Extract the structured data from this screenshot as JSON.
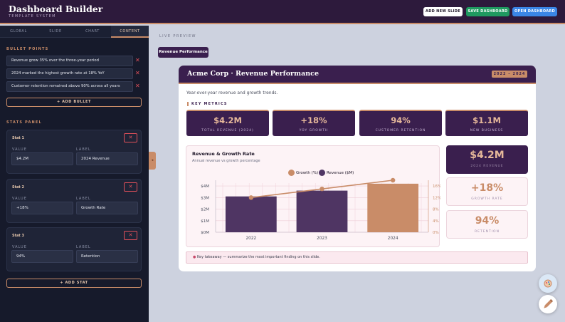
{
  "header": {
    "title": "Dashboard Builder",
    "subtitle": "TEMPLATE SYSTEM",
    "add_slide": "ADD NEW SLIDE",
    "save": "SAVE DASHBOARD",
    "open": "OPEN DASHBOARD"
  },
  "sidebar": {
    "tabs": [
      "GLOBAL",
      "SLIDE",
      "CHART",
      "CONTENT"
    ],
    "active_tab": "CONTENT",
    "bullets_label": "BULLET POINTS",
    "bullets": [
      "Revenue grew 35% over the three-year period",
      "2024 marked the highest growth rate at 18% YoY",
      "Customer retention remained above 90% across all years"
    ],
    "add_bullet": "+ ADD BULLET",
    "stats_label": "STATS PANEL",
    "value_label": "VALUE",
    "label_label": "LABEL",
    "stats": [
      {
        "title": "Stat 1",
        "value": "$4.2M",
        "label": "2024 Revenue"
      },
      {
        "title": "Stat 2",
        "value": "+18%",
        "label": "Growth Rate"
      },
      {
        "title": "Stat 3",
        "value": "94%",
        "label": "Retention"
      }
    ],
    "add_stat": "+ ADD STAT"
  },
  "preview": {
    "label": "LIVE PREVIEW",
    "slide_pill": "Revenue Performance"
  },
  "slide": {
    "title": "Acme Corp · Revenue Performance",
    "years": "2022 – 2024",
    "subtitle": "Year-over-year revenue and growth trends.",
    "key_metrics_label": "KEY METRICS",
    "kpis": [
      {
        "value": "$4.2M",
        "label": "TOTAL REVENUE (2024)"
      },
      {
        "value": "+18%",
        "label": "YOY GROWTH"
      },
      {
        "value": "94%",
        "label": "CUSTOMER RETENTION"
      },
      {
        "value": "$1.1M",
        "label": "NEW BUSINESS"
      }
    ],
    "side_stats": [
      {
        "value": "$4.2M",
        "label": "2024 REVENUE"
      },
      {
        "value": "+18%",
        "label": "GROWTH RATE"
      },
      {
        "value": "94%",
        "label": "RETENTION"
      }
    ],
    "takeaway": "Key takeaway — summarize the most important finding on this slide."
  },
  "chart_data": {
    "type": "bar",
    "title": "Revenue & Growth Rate",
    "subtitle": "Annual revenue vs growth percentage",
    "categories": [
      "2022",
      "2023",
      "2024"
    ],
    "series": [
      {
        "name": "Revenue ($M)",
        "type": "bar",
        "axis": "left",
        "values": [
          3.1,
          3.6,
          4.2
        ],
        "color": "#4f3563"
      },
      {
        "name": "Growth (%)",
        "type": "line",
        "axis": "right",
        "values": [
          12,
          15,
          18
        ],
        "color": "#c98c68"
      }
    ],
    "y_left": {
      "ticks": [
        "$0M",
        "$1M",
        "$2M",
        "$3M",
        "$4M"
      ],
      "range": [
        0,
        4.5
      ]
    },
    "y_right": {
      "ticks": [
        "0%",
        "4%",
        "8%",
        "12%",
        "16%"
      ],
      "range": [
        0,
        18
      ]
    },
    "last_bar_color": "#c98c68",
    "legend_position": "top",
    "grid": true
  },
  "colors": {
    "brand": "#3a1f4e",
    "accent": "#c98c68",
    "danger": "#e0505a",
    "save": "#1f9a60",
    "open": "#3a86e6"
  },
  "icons": {
    "fab_top": "palette-icon",
    "fab_bottom": "pencil-icon",
    "remove": "close-icon",
    "collapse": "chevron-left-icon"
  }
}
